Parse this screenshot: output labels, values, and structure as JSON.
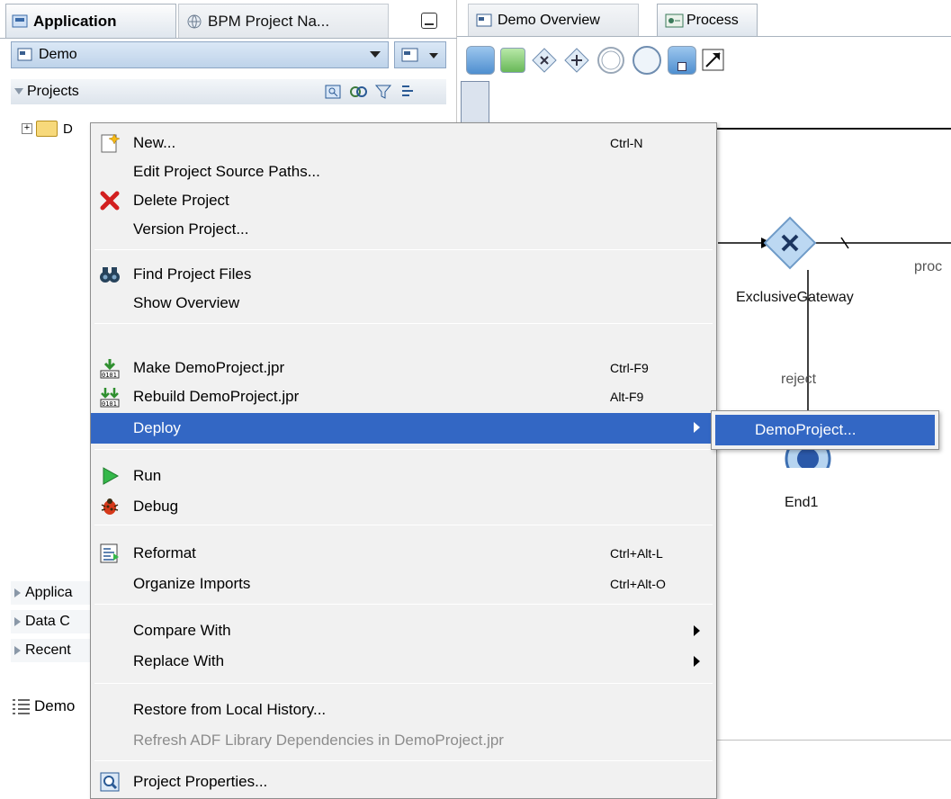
{
  "left_panel": {
    "tabs": [
      {
        "label": "Application"
      },
      {
        "label": "BPM Project Na..."
      }
    ],
    "app_combo": "Demo",
    "projects_header": "Projects",
    "tree_node_label": "D",
    "accordions": [
      {
        "label": "Applica"
      },
      {
        "label": "Data C"
      },
      {
        "label": "Recent"
      }
    ],
    "bottom_tab": "Demo"
  },
  "editor": {
    "tabs": [
      {
        "label": "Demo Overview"
      },
      {
        "label": "Process"
      }
    ],
    "canvas_labels": {
      "gateway": "ExclusiveGateway",
      "reject": "reject",
      "process": "proc",
      "end": "End1"
    }
  },
  "context_menu": {
    "items": [
      {
        "label": "New...",
        "shortcut": "Ctrl-N",
        "icon": "new-icon"
      },
      {
        "label": "Edit Project Source Paths...",
        "shortcut": "",
        "icon": ""
      },
      {
        "label": "Delete Project",
        "shortcut": "",
        "icon": "delete-icon"
      },
      {
        "label": "Version Project...",
        "shortcut": "",
        "icon": ""
      },
      {
        "label": "Find Project Files",
        "shortcut": "",
        "icon": "binoculars-icon"
      },
      {
        "label": "Show Overview",
        "shortcut": "",
        "icon": ""
      },
      {
        "label": "Make DemoProject.jpr",
        "shortcut": "Ctrl-F9",
        "icon": "make-icon"
      },
      {
        "label": "Rebuild DemoProject.jpr",
        "shortcut": "Alt-F9",
        "icon": "rebuild-icon"
      },
      {
        "label": "Deploy",
        "shortcut": "",
        "icon": "",
        "selected": true,
        "submenu": true
      },
      {
        "label": "Run",
        "shortcut": "",
        "icon": "run-icon"
      },
      {
        "label": "Debug",
        "shortcut": "",
        "icon": "debug-icon"
      },
      {
        "label": "Reformat",
        "shortcut": "Ctrl+Alt-L",
        "icon": "reformat-icon"
      },
      {
        "label": "Organize Imports",
        "shortcut": "Ctrl+Alt-O",
        "icon": ""
      },
      {
        "label": "Compare With",
        "shortcut": "",
        "icon": "",
        "submenu": true
      },
      {
        "label": "Replace With",
        "shortcut": "",
        "icon": "",
        "submenu": true
      },
      {
        "label": "Restore from Local History...",
        "shortcut": "",
        "icon": ""
      },
      {
        "label": "Refresh ADF Library Dependencies in DemoProject.jpr",
        "shortcut": "",
        "icon": "",
        "disabled": true
      },
      {
        "label": "Project Properties...",
        "shortcut": "",
        "icon": "properties-icon"
      }
    ]
  },
  "submenu": {
    "item": "DemoProject..."
  }
}
